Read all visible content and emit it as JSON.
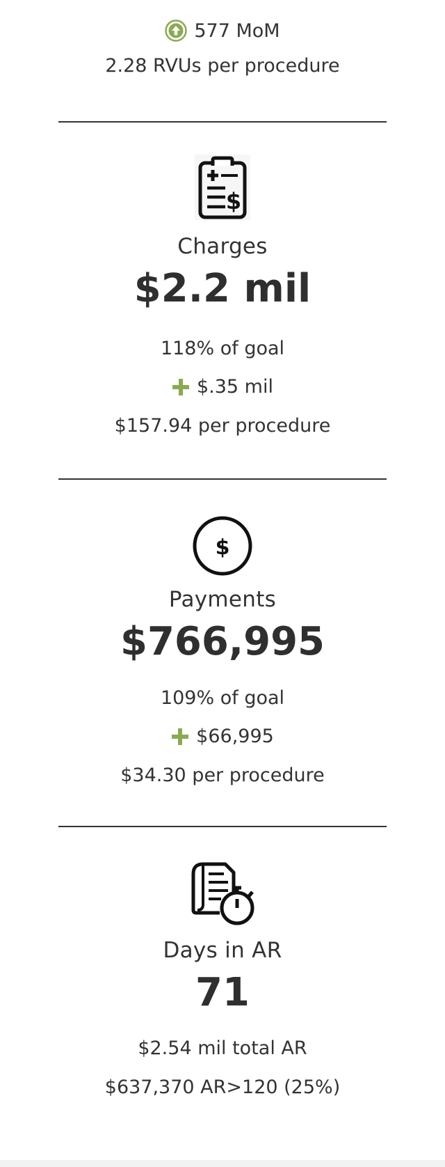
{
  "rvus": {
    "mom_delta": "577 MoM",
    "per_procedure": "2.28 RVUs per procedure",
    "trend_icon": "arrow-up-circle-icon",
    "trend_color": "#8aaa52"
  },
  "charges": {
    "icon": "clipboard-dollar-icon",
    "label": "Charges",
    "value": "$2.2 mil",
    "goal_pct": "118% of goal",
    "delta": "$.35 mil",
    "per_procedure": "$157.94 per procedure",
    "delta_icon": "plus-icon"
  },
  "payments": {
    "icon": "dollar-coin-icon",
    "label": "Payments",
    "value": "$766,995",
    "goal_pct": "109% of goal",
    "delta": "$66,995",
    "per_procedure": "$34.30 per procedure",
    "delta_icon": "plus-icon"
  },
  "days_in_ar": {
    "icon": "document-stopwatch-icon",
    "label": "Days in AR",
    "value": "71",
    "total_ar": "$2.54 mil total AR",
    "ar_over_120": "$637,370 AR>120 (25%)"
  },
  "colors": {
    "positive_green": "#8aaa52",
    "text": "#333333",
    "divider": "#333333"
  }
}
